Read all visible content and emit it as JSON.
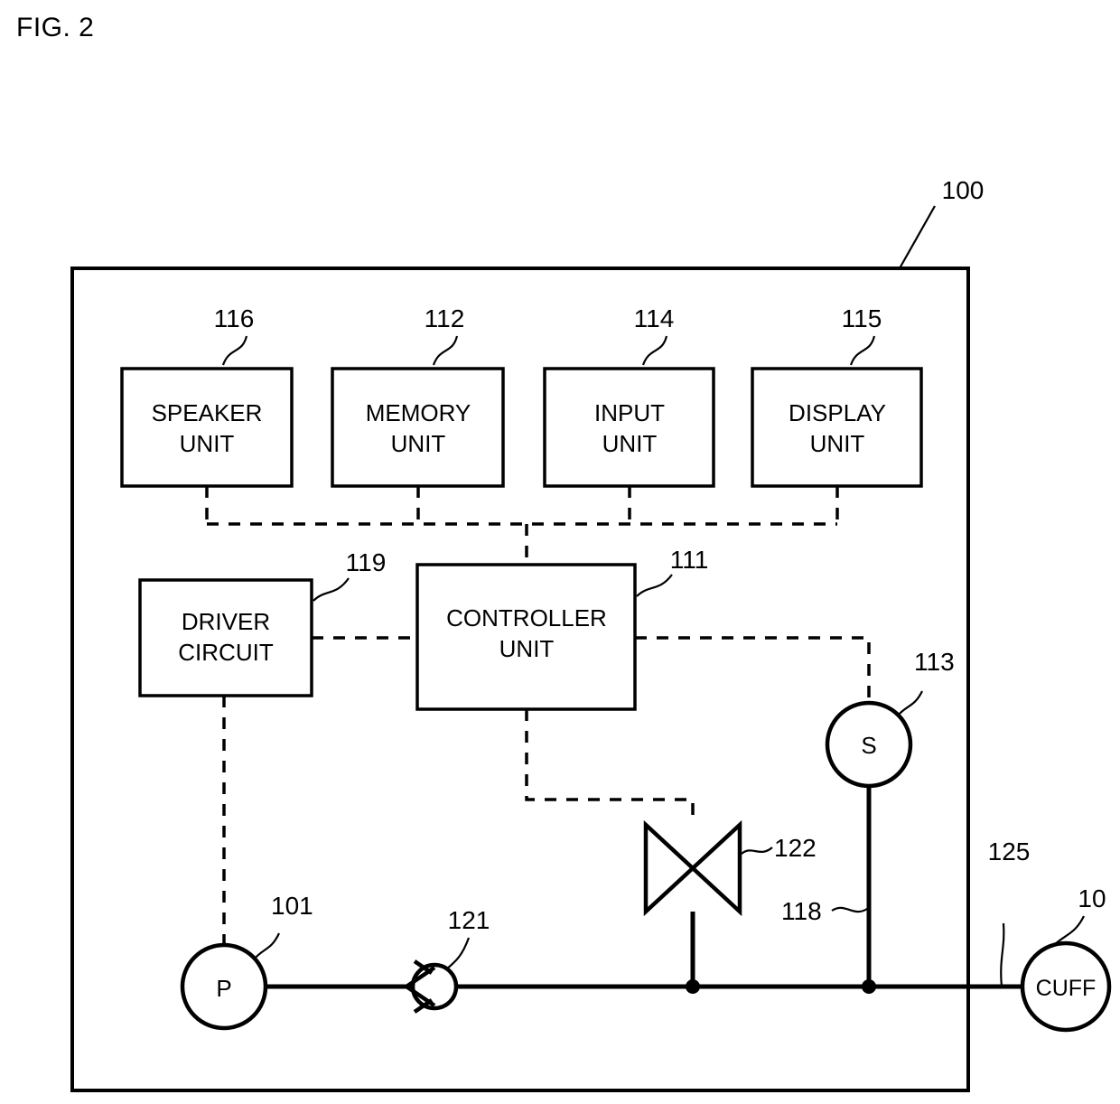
{
  "figure": {
    "title": "FIG. 2",
    "overall_ref": "100"
  },
  "top_blocks": [
    {
      "label_line1": "SPEAKER",
      "label_line2": "UNIT",
      "ref": "116"
    },
    {
      "label_line1": "MEMORY",
      "label_line2": "UNIT",
      "ref": "112"
    },
    {
      "label_line1": "INPUT",
      "label_line2": "UNIT",
      "ref": "114"
    },
    {
      "label_line1": "DISPLAY",
      "label_line2": "UNIT",
      "ref": "115"
    }
  ],
  "mid_blocks": [
    {
      "label_line1": "DRIVER",
      "label_line2": "CIRCUIT",
      "ref": "119"
    },
    {
      "label_line1": "CONTROLLER",
      "label_line2": "UNIT",
      "ref": "111"
    }
  ],
  "nodes": {
    "sensor": {
      "symbol": "S",
      "ref": "113"
    },
    "pump": {
      "symbol": "P",
      "ref": "101"
    },
    "check_valve": {
      "ref": "121"
    },
    "control_valve": {
      "ref": "122"
    },
    "cuff": {
      "label": "CUFF",
      "ref": "10"
    }
  },
  "tubes": {
    "sensor_tube_ref": "118",
    "cuff_tube_ref": "125"
  },
  "colors": {
    "ink": "#000000",
    "paper": "#ffffff"
  }
}
